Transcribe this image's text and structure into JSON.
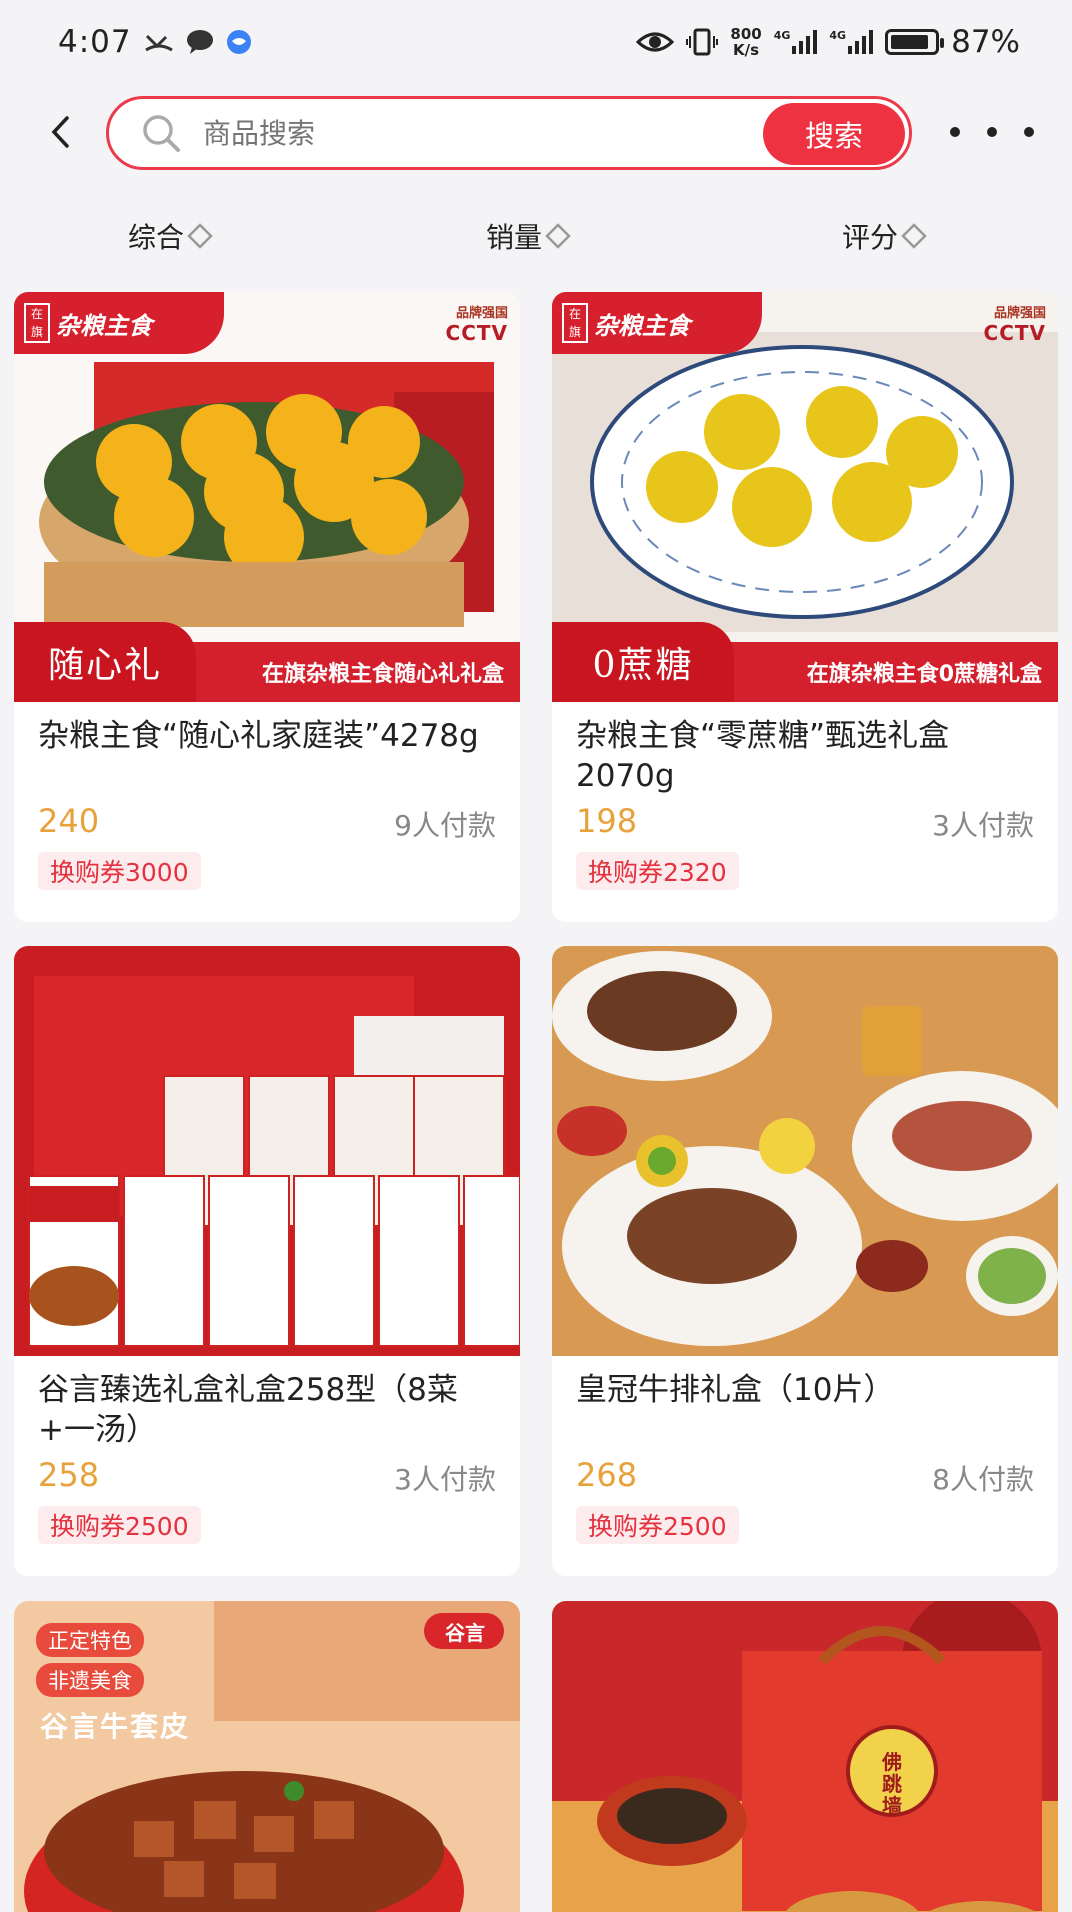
{
  "status_bar": {
    "time": "4:07",
    "net_speed_value": "800",
    "net_speed_unit": "K/s",
    "signal1_label": "4G",
    "signal2_label": "4G",
    "battery": "87%",
    "battery_level": 0.87
  },
  "search": {
    "placeholder": "商品搜索",
    "button_label": "搜索"
  },
  "sort": {
    "items": [
      "综合",
      "销量",
      "评分"
    ]
  },
  "products": [
    {
      "title": "杂粮主食“随心礼家庭装”4278g",
      "price": "240",
      "sold": "9人付款",
      "coupon": "换购券3000",
      "brand": "杂粮主食",
      "brand_mark": "在旗",
      "cctv_small": "品牌强国",
      "cctv_big": "CCTV",
      "banner_big": "随心礼",
      "banner_text": "在旗杂粮主食随心礼礼盒"
    },
    {
      "title": "杂粮主食“零蔗糖”甄选礼盒2070g",
      "price": "198",
      "sold": "3人付款",
      "coupon": "换购券2320",
      "brand": "杂粮主食",
      "brand_mark": "在旗",
      "cctv_small": "品牌强国",
      "cctv_big": "CCTV",
      "banner_big": "0蔗糖",
      "banner_text": "在旗杂粮主食0蔗糖礼盒"
    },
    {
      "title": "谷言臻选礼盒礼盒258型（8菜+一汤）",
      "price": "258",
      "sold": "3人付款",
      "coupon": "换购券2500"
    },
    {
      "title": "皇冠牛排礼盒（10片）",
      "price": "268",
      "sold": "8人付款",
      "coupon": "换购券2500"
    },
    {
      "pill1": "正定特色",
      "pill2": "非遗美食",
      "headline": "谷言牛套皮",
      "logo": "谷言"
    },
    {
      "box_text": "佛跳墙"
    }
  ]
}
